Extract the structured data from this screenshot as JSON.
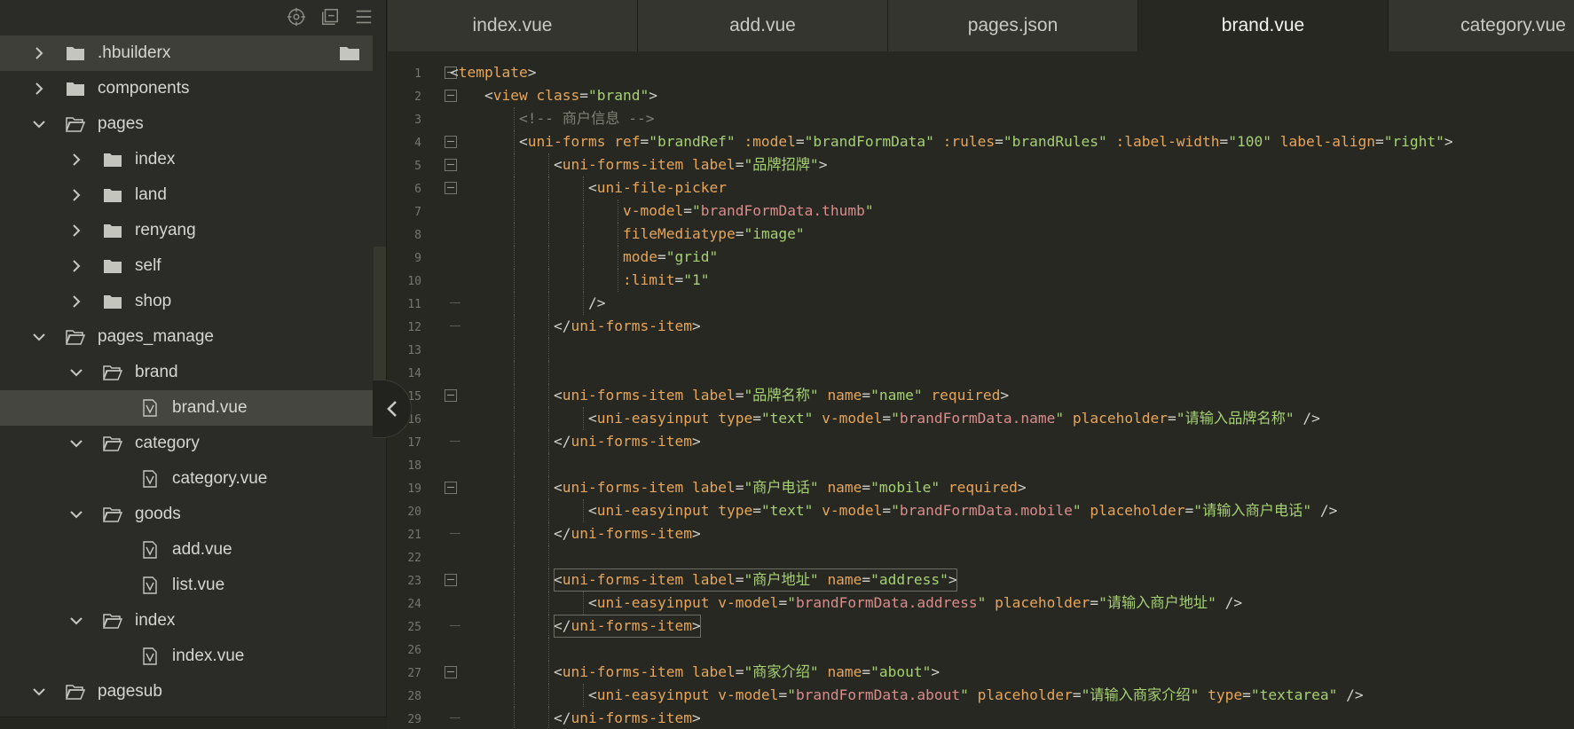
{
  "sidebar": {
    "toolbar_icons": [
      "target-icon",
      "collapse-all-icon",
      "menu-icon"
    ],
    "tree": [
      {
        "label": ".hbuilderx",
        "depth": 0,
        "type": "folder",
        "expanded": false,
        "state": "hover"
      },
      {
        "label": "components",
        "depth": 0,
        "type": "folder",
        "expanded": false
      },
      {
        "label": "pages",
        "depth": 0,
        "type": "folder",
        "expanded": true
      },
      {
        "label": "index",
        "depth": 1,
        "type": "folder",
        "expanded": false
      },
      {
        "label": "land",
        "depth": 1,
        "type": "folder",
        "expanded": false
      },
      {
        "label": "renyang",
        "depth": 1,
        "type": "folder",
        "expanded": false
      },
      {
        "label": "self",
        "depth": 1,
        "type": "folder",
        "expanded": false
      },
      {
        "label": "shop",
        "depth": 1,
        "type": "folder",
        "expanded": false
      },
      {
        "label": "pages_manage",
        "depth": 0,
        "type": "folder",
        "expanded": true
      },
      {
        "label": "brand",
        "depth": 1,
        "type": "folder",
        "expanded": true
      },
      {
        "label": "brand.vue",
        "depth": 2,
        "type": "file",
        "state": "selected"
      },
      {
        "label": "category",
        "depth": 1,
        "type": "folder",
        "expanded": true
      },
      {
        "label": "category.vue",
        "depth": 2,
        "type": "file"
      },
      {
        "label": "goods",
        "depth": 1,
        "type": "folder",
        "expanded": true
      },
      {
        "label": "add.vue",
        "depth": 2,
        "type": "file"
      },
      {
        "label": "list.vue",
        "depth": 2,
        "type": "file"
      },
      {
        "label": "index",
        "depth": 1,
        "type": "folder",
        "expanded": true
      },
      {
        "label": "index.vue",
        "depth": 2,
        "type": "file"
      },
      {
        "label": "pagesub",
        "depth": 0,
        "type": "folder",
        "expanded": true
      }
    ]
  },
  "tabs": [
    {
      "label": "index.vue",
      "active": false
    },
    {
      "label": "add.vue",
      "active": false
    },
    {
      "label": "pages.json",
      "active": false
    },
    {
      "label": "brand.vue",
      "active": true
    },
    {
      "label": "category.vue",
      "active": false
    }
  ],
  "editor": {
    "lines": [
      {
        "n": "1",
        "indent": 0,
        "fold": "start",
        "tokens": [
          [
            "br",
            "<"
          ],
          [
            "tag",
            "template"
          ],
          [
            "br",
            ">"
          ]
        ]
      },
      {
        "n": "2",
        "indent": 1,
        "fold": "start",
        "tokens": [
          [
            "br",
            "<"
          ],
          [
            "tag",
            "view"
          ],
          [
            "txt",
            " "
          ],
          [
            "attr",
            "class"
          ],
          [
            "eq",
            "="
          ],
          [
            "str",
            "\"brand\""
          ],
          [
            "br",
            ">"
          ]
        ]
      },
      {
        "n": "3",
        "indent": 2,
        "fold": "",
        "tokens": [
          [
            "com",
            "<!-- 商户信息 -->"
          ]
        ]
      },
      {
        "n": "4",
        "indent": 2,
        "fold": "start",
        "tokens": [
          [
            "br",
            "<"
          ],
          [
            "tag",
            "uni-forms"
          ],
          [
            "txt",
            " "
          ],
          [
            "attr",
            "ref"
          ],
          [
            "eq",
            "="
          ],
          [
            "str",
            "\"brandRef\""
          ],
          [
            "txt",
            " "
          ],
          [
            "attr",
            ":model"
          ],
          [
            "eq",
            "="
          ],
          [
            "str",
            "\"brandFormData\""
          ],
          [
            "txt",
            " "
          ],
          [
            "attr",
            ":rules"
          ],
          [
            "eq",
            "="
          ],
          [
            "str",
            "\"brandRules\""
          ],
          [
            "txt",
            " "
          ],
          [
            "attr",
            ":label-width"
          ],
          [
            "eq",
            "="
          ],
          [
            "str",
            "\"100\""
          ],
          [
            "txt",
            " "
          ],
          [
            "attr",
            "label-align"
          ],
          [
            "eq",
            "="
          ],
          [
            "str",
            "\"right\""
          ],
          [
            "br",
            ">"
          ]
        ]
      },
      {
        "n": "5",
        "indent": 3,
        "fold": "start",
        "tokens": [
          [
            "br",
            "<"
          ],
          [
            "tag",
            "uni-forms-item"
          ],
          [
            "txt",
            " "
          ],
          [
            "attr",
            "label"
          ],
          [
            "eq",
            "="
          ],
          [
            "str",
            "\"品牌招牌\""
          ],
          [
            "br",
            ">"
          ]
        ]
      },
      {
        "n": "6",
        "indent": 4,
        "fold": "start",
        "tokens": [
          [
            "br",
            "<"
          ],
          [
            "tag",
            "uni-file-picker"
          ]
        ]
      },
      {
        "n": "7",
        "indent": 5,
        "fold": "",
        "tokens": [
          [
            "attr",
            "v-model"
          ],
          [
            "eq",
            "="
          ],
          [
            "str",
            "\""
          ],
          [
            "strb",
            "brandFormData.thumb"
          ],
          [
            "str",
            "\""
          ]
        ]
      },
      {
        "n": "8",
        "indent": 5,
        "fold": "",
        "tokens": [
          [
            "attr",
            "fileMediatype"
          ],
          [
            "eq",
            "="
          ],
          [
            "str",
            "\"image\""
          ]
        ]
      },
      {
        "n": "9",
        "indent": 5,
        "fold": "",
        "tokens": [
          [
            "attr",
            "mode"
          ],
          [
            "eq",
            "="
          ],
          [
            "str",
            "\"grid\""
          ]
        ]
      },
      {
        "n": "10",
        "indent": 5,
        "fold": "",
        "tokens": [
          [
            "attr",
            ":limit"
          ],
          [
            "eq",
            "="
          ],
          [
            "str",
            "\"1\""
          ]
        ]
      },
      {
        "n": "11",
        "indent": 4,
        "fold": "end",
        "tokens": [
          [
            "br",
            "/>"
          ]
        ]
      },
      {
        "n": "12",
        "indent": 3,
        "fold": "end",
        "tokens": [
          [
            "br",
            "</"
          ],
          [
            "tag",
            "uni-forms-item"
          ],
          [
            "br",
            ">"
          ]
        ]
      },
      {
        "n": "13",
        "indent": 3,
        "fold": "",
        "tokens": []
      },
      {
        "n": "14",
        "indent": 3,
        "fold": "",
        "tokens": []
      },
      {
        "n": "15",
        "indent": 3,
        "fold": "start",
        "tokens": [
          [
            "br",
            "<"
          ],
          [
            "tag",
            "uni-forms-item"
          ],
          [
            "txt",
            " "
          ],
          [
            "attr",
            "label"
          ],
          [
            "eq",
            "="
          ],
          [
            "str",
            "\"品牌名称\""
          ],
          [
            "txt",
            " "
          ],
          [
            "attr",
            "name"
          ],
          [
            "eq",
            "="
          ],
          [
            "str",
            "\"name\""
          ],
          [
            "txt",
            " "
          ],
          [
            "attr",
            "required"
          ],
          [
            "br",
            ">"
          ]
        ]
      },
      {
        "n": "16",
        "indent": 4,
        "fold": "",
        "tokens": [
          [
            "br",
            "<"
          ],
          [
            "tag",
            "uni-easyinput"
          ],
          [
            "txt",
            " "
          ],
          [
            "attr",
            "type"
          ],
          [
            "eq",
            "="
          ],
          [
            "str",
            "\"text\""
          ],
          [
            "txt",
            " "
          ],
          [
            "attr",
            "v-model"
          ],
          [
            "eq",
            "="
          ],
          [
            "str",
            "\""
          ],
          [
            "strb",
            "brandFormData.name"
          ],
          [
            "str",
            "\""
          ],
          [
            "txt",
            " "
          ],
          [
            "attr",
            "placeholder"
          ],
          [
            "eq",
            "="
          ],
          [
            "str",
            "\"请输入品牌名称\""
          ],
          [
            "txt",
            " "
          ],
          [
            "br",
            "/>"
          ]
        ]
      },
      {
        "n": "17",
        "indent": 3,
        "fold": "end",
        "tokens": [
          [
            "br",
            "</"
          ],
          [
            "tag",
            "uni-forms-item"
          ],
          [
            "br",
            ">"
          ]
        ]
      },
      {
        "n": "18",
        "indent": 3,
        "fold": "",
        "tokens": []
      },
      {
        "n": "19",
        "indent": 3,
        "fold": "start",
        "tokens": [
          [
            "br",
            "<"
          ],
          [
            "tag",
            "uni-forms-item"
          ],
          [
            "txt",
            " "
          ],
          [
            "attr",
            "label"
          ],
          [
            "eq",
            "="
          ],
          [
            "str",
            "\"商户电话\""
          ],
          [
            "txt",
            " "
          ],
          [
            "attr",
            "name"
          ],
          [
            "eq",
            "="
          ],
          [
            "str",
            "\"mobile\""
          ],
          [
            "txt",
            " "
          ],
          [
            "attr",
            "required"
          ],
          [
            "br",
            ">"
          ]
        ]
      },
      {
        "n": "20",
        "indent": 4,
        "fold": "",
        "tokens": [
          [
            "br",
            "<"
          ],
          [
            "tag",
            "uni-easyinput"
          ],
          [
            "txt",
            " "
          ],
          [
            "attr",
            "type"
          ],
          [
            "eq",
            "="
          ],
          [
            "str",
            "\"text\""
          ],
          [
            "txt",
            " "
          ],
          [
            "attr",
            "v-model"
          ],
          [
            "eq",
            "="
          ],
          [
            "str",
            "\""
          ],
          [
            "strb",
            "brandFormData.mobile"
          ],
          [
            "str",
            "\""
          ],
          [
            "txt",
            " "
          ],
          [
            "attr",
            "placeholder"
          ],
          [
            "eq",
            "="
          ],
          [
            "str",
            "\"请输入商户电话\""
          ],
          [
            "txt",
            " "
          ],
          [
            "br",
            "/>"
          ]
        ]
      },
      {
        "n": "21",
        "indent": 3,
        "fold": "end",
        "tokens": [
          [
            "br",
            "</"
          ],
          [
            "tag",
            "uni-forms-item"
          ],
          [
            "br",
            ">"
          ]
        ]
      },
      {
        "n": "22",
        "indent": 3,
        "fold": "",
        "tokens": []
      },
      {
        "n": "23",
        "indent": 3,
        "fold": "start",
        "box": true,
        "tokens": [
          [
            "br",
            "<"
          ],
          [
            "tag",
            "uni-forms-item"
          ],
          [
            "txt",
            " "
          ],
          [
            "attr",
            "label"
          ],
          [
            "eq",
            "="
          ],
          [
            "str",
            "\"商户地址\""
          ],
          [
            "txt",
            " "
          ],
          [
            "attr",
            "name"
          ],
          [
            "eq",
            "="
          ],
          [
            "str",
            "\"address\""
          ],
          [
            "br",
            ">"
          ]
        ]
      },
      {
        "n": "24",
        "indent": 4,
        "fold": "",
        "tokens": [
          [
            "br",
            "<"
          ],
          [
            "tag",
            "uni-easyinput"
          ],
          [
            "txt",
            " "
          ],
          [
            "attr",
            "v-model"
          ],
          [
            "eq",
            "="
          ],
          [
            "str",
            "\""
          ],
          [
            "strb",
            "brandFormData.address"
          ],
          [
            "str",
            "\""
          ],
          [
            "txt",
            " "
          ],
          [
            "attr",
            "placeholder"
          ],
          [
            "eq",
            "="
          ],
          [
            "str",
            "\"请输入商户地址\""
          ],
          [
            "txt",
            " "
          ],
          [
            "br",
            "/>"
          ]
        ]
      },
      {
        "n": "25",
        "indent": 3,
        "fold": "end",
        "box": true,
        "tokens": [
          [
            "br",
            "</"
          ],
          [
            "tag",
            "uni-forms-item"
          ],
          [
            "br",
            ">"
          ]
        ]
      },
      {
        "n": "26",
        "indent": 3,
        "fold": "",
        "tokens": []
      },
      {
        "n": "27",
        "indent": 3,
        "fold": "start",
        "tokens": [
          [
            "br",
            "<"
          ],
          [
            "tag",
            "uni-forms-item"
          ],
          [
            "txt",
            " "
          ],
          [
            "attr",
            "label"
          ],
          [
            "eq",
            "="
          ],
          [
            "str",
            "\"商家介绍\""
          ],
          [
            "txt",
            " "
          ],
          [
            "attr",
            "name"
          ],
          [
            "eq",
            "="
          ],
          [
            "str",
            "\"about\""
          ],
          [
            "br",
            ">"
          ]
        ]
      },
      {
        "n": "28",
        "indent": 4,
        "fold": "",
        "tokens": [
          [
            "br",
            "<"
          ],
          [
            "tag",
            "uni-easyinput"
          ],
          [
            "txt",
            " "
          ],
          [
            "attr",
            "v-model"
          ],
          [
            "eq",
            "="
          ],
          [
            "str",
            "\""
          ],
          [
            "strb",
            "brandFormData.about"
          ],
          [
            "str",
            "\""
          ],
          [
            "txt",
            " "
          ],
          [
            "attr",
            "placeholder"
          ],
          [
            "eq",
            "="
          ],
          [
            "str",
            "\"请输入商家介绍\""
          ],
          [
            "txt",
            " "
          ],
          [
            "attr",
            "type"
          ],
          [
            "eq",
            "="
          ],
          [
            "str",
            "\"textarea\""
          ],
          [
            "txt",
            " "
          ],
          [
            "br",
            "/>"
          ]
        ]
      },
      {
        "n": "29",
        "indent": 3,
        "fold": "end",
        "tokens": [
          [
            "br",
            "</"
          ],
          [
            "tag",
            "uni-forms-item"
          ],
          [
            "br",
            ">"
          ]
        ]
      }
    ]
  },
  "colors": {
    "background": "#272822",
    "sidebar": "#2b2c27",
    "tag": "#e6a55b",
    "string": "#a6d074",
    "string_binding": "#d98c8c",
    "comment": "#7f8075"
  }
}
